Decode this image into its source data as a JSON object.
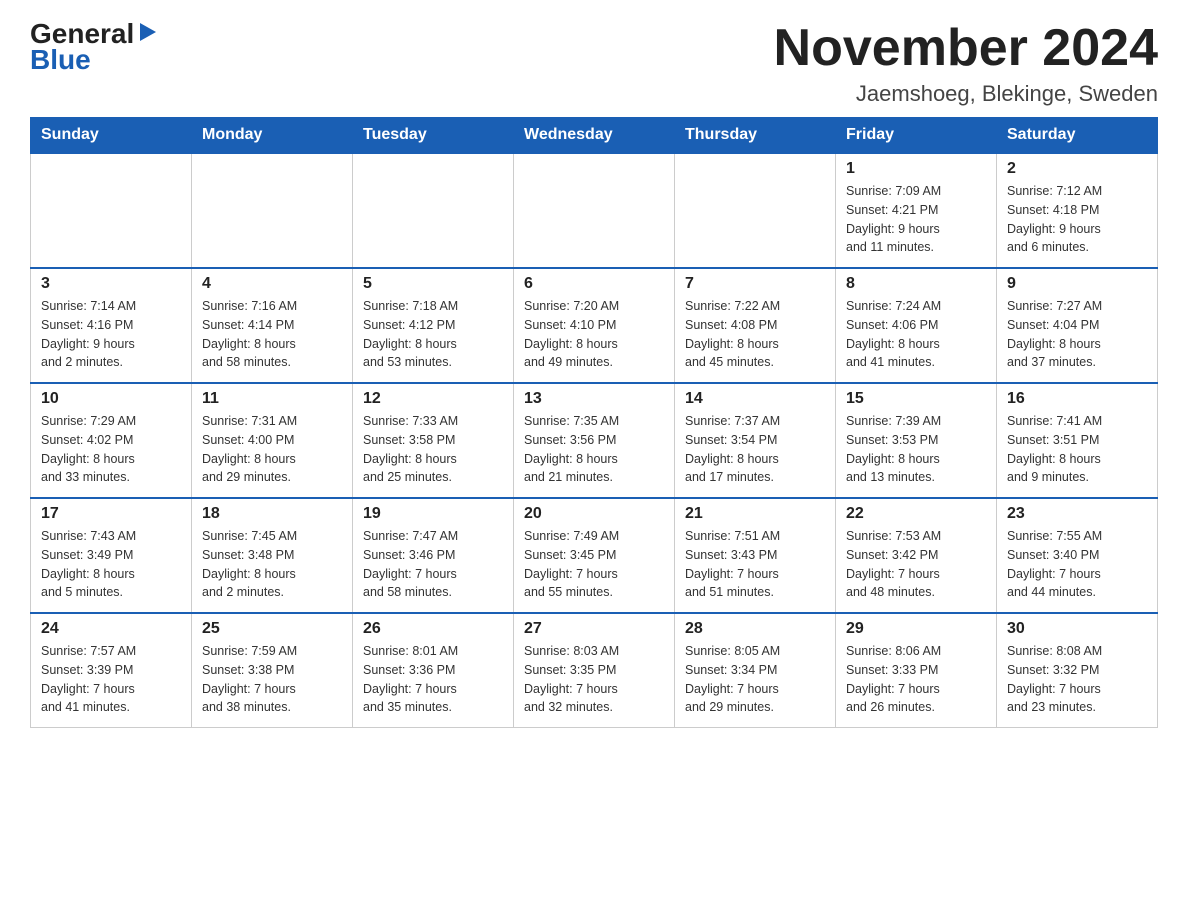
{
  "logo": {
    "general": "General",
    "blue": "Blue",
    "triangle": "▶"
  },
  "title": {
    "month": "November 2024",
    "location": "Jaemshoeg, Blekinge, Sweden"
  },
  "headers": [
    "Sunday",
    "Monday",
    "Tuesday",
    "Wednesday",
    "Thursday",
    "Friday",
    "Saturday"
  ],
  "weeks": [
    [
      {
        "day": "",
        "info": ""
      },
      {
        "day": "",
        "info": ""
      },
      {
        "day": "",
        "info": ""
      },
      {
        "day": "",
        "info": ""
      },
      {
        "day": "",
        "info": ""
      },
      {
        "day": "1",
        "info": "Sunrise: 7:09 AM\nSunset: 4:21 PM\nDaylight: 9 hours\nand 11 minutes."
      },
      {
        "day": "2",
        "info": "Sunrise: 7:12 AM\nSunset: 4:18 PM\nDaylight: 9 hours\nand 6 minutes."
      }
    ],
    [
      {
        "day": "3",
        "info": "Sunrise: 7:14 AM\nSunset: 4:16 PM\nDaylight: 9 hours\nand 2 minutes."
      },
      {
        "day": "4",
        "info": "Sunrise: 7:16 AM\nSunset: 4:14 PM\nDaylight: 8 hours\nand 58 minutes."
      },
      {
        "day": "5",
        "info": "Sunrise: 7:18 AM\nSunset: 4:12 PM\nDaylight: 8 hours\nand 53 minutes."
      },
      {
        "day": "6",
        "info": "Sunrise: 7:20 AM\nSunset: 4:10 PM\nDaylight: 8 hours\nand 49 minutes."
      },
      {
        "day": "7",
        "info": "Sunrise: 7:22 AM\nSunset: 4:08 PM\nDaylight: 8 hours\nand 45 minutes."
      },
      {
        "day": "8",
        "info": "Sunrise: 7:24 AM\nSunset: 4:06 PM\nDaylight: 8 hours\nand 41 minutes."
      },
      {
        "day": "9",
        "info": "Sunrise: 7:27 AM\nSunset: 4:04 PM\nDaylight: 8 hours\nand 37 minutes."
      }
    ],
    [
      {
        "day": "10",
        "info": "Sunrise: 7:29 AM\nSunset: 4:02 PM\nDaylight: 8 hours\nand 33 minutes."
      },
      {
        "day": "11",
        "info": "Sunrise: 7:31 AM\nSunset: 4:00 PM\nDaylight: 8 hours\nand 29 minutes."
      },
      {
        "day": "12",
        "info": "Sunrise: 7:33 AM\nSunset: 3:58 PM\nDaylight: 8 hours\nand 25 minutes."
      },
      {
        "day": "13",
        "info": "Sunrise: 7:35 AM\nSunset: 3:56 PM\nDaylight: 8 hours\nand 21 minutes."
      },
      {
        "day": "14",
        "info": "Sunrise: 7:37 AM\nSunset: 3:54 PM\nDaylight: 8 hours\nand 17 minutes."
      },
      {
        "day": "15",
        "info": "Sunrise: 7:39 AM\nSunset: 3:53 PM\nDaylight: 8 hours\nand 13 minutes."
      },
      {
        "day": "16",
        "info": "Sunrise: 7:41 AM\nSunset: 3:51 PM\nDaylight: 8 hours\nand 9 minutes."
      }
    ],
    [
      {
        "day": "17",
        "info": "Sunrise: 7:43 AM\nSunset: 3:49 PM\nDaylight: 8 hours\nand 5 minutes."
      },
      {
        "day": "18",
        "info": "Sunrise: 7:45 AM\nSunset: 3:48 PM\nDaylight: 8 hours\nand 2 minutes."
      },
      {
        "day": "19",
        "info": "Sunrise: 7:47 AM\nSunset: 3:46 PM\nDaylight: 7 hours\nand 58 minutes."
      },
      {
        "day": "20",
        "info": "Sunrise: 7:49 AM\nSunset: 3:45 PM\nDaylight: 7 hours\nand 55 minutes."
      },
      {
        "day": "21",
        "info": "Sunrise: 7:51 AM\nSunset: 3:43 PM\nDaylight: 7 hours\nand 51 minutes."
      },
      {
        "day": "22",
        "info": "Sunrise: 7:53 AM\nSunset: 3:42 PM\nDaylight: 7 hours\nand 48 minutes."
      },
      {
        "day": "23",
        "info": "Sunrise: 7:55 AM\nSunset: 3:40 PM\nDaylight: 7 hours\nand 44 minutes."
      }
    ],
    [
      {
        "day": "24",
        "info": "Sunrise: 7:57 AM\nSunset: 3:39 PM\nDaylight: 7 hours\nand 41 minutes."
      },
      {
        "day": "25",
        "info": "Sunrise: 7:59 AM\nSunset: 3:38 PM\nDaylight: 7 hours\nand 38 minutes."
      },
      {
        "day": "26",
        "info": "Sunrise: 8:01 AM\nSunset: 3:36 PM\nDaylight: 7 hours\nand 35 minutes."
      },
      {
        "day": "27",
        "info": "Sunrise: 8:03 AM\nSunset: 3:35 PM\nDaylight: 7 hours\nand 32 minutes."
      },
      {
        "day": "28",
        "info": "Sunrise: 8:05 AM\nSunset: 3:34 PM\nDaylight: 7 hours\nand 29 minutes."
      },
      {
        "day": "29",
        "info": "Sunrise: 8:06 AM\nSunset: 3:33 PM\nDaylight: 7 hours\nand 26 minutes."
      },
      {
        "day": "30",
        "info": "Sunrise: 8:08 AM\nSunset: 3:32 PM\nDaylight: 7 hours\nand 23 minutes."
      }
    ]
  ]
}
